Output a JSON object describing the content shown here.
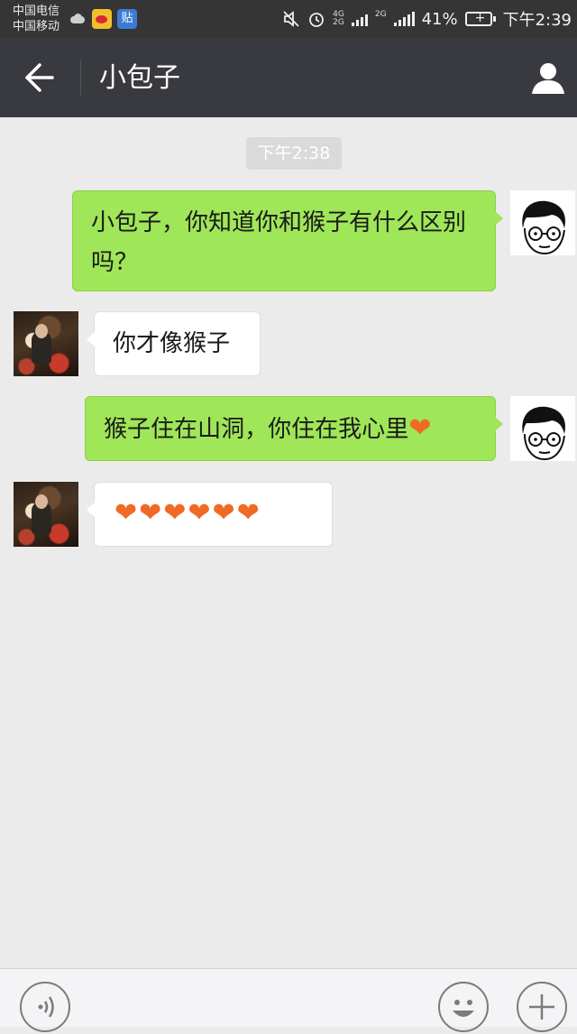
{
  "status_bar": {
    "carrier_1": "中国电信",
    "carrier_2": "中国移动",
    "tieba_label": "贴",
    "network_top": "4G",
    "network_bottom": "2G",
    "network_2": "2G",
    "battery": "41%",
    "time": "下午2:39"
  },
  "header": {
    "title": "小包子"
  },
  "chat": {
    "timestamp": "下午2:38",
    "messages": [
      {
        "sender": "me",
        "text": "小包子，你知道你和猴子有什么区别吗？"
      },
      {
        "sender": "friend",
        "text": "你才像猴子"
      },
      {
        "sender": "me",
        "text": "猴子住在山洞，你住在我心里❤"
      },
      {
        "sender": "friend",
        "text": "❤❤❤❤❤❤"
      }
    ]
  },
  "colors": {
    "outgoing_bubble": "#9fe658",
    "incoming_bubble": "#ffffff",
    "titlebar": "#393a3f",
    "statusbar": "#353535",
    "chat_background": "#ebebeb"
  }
}
